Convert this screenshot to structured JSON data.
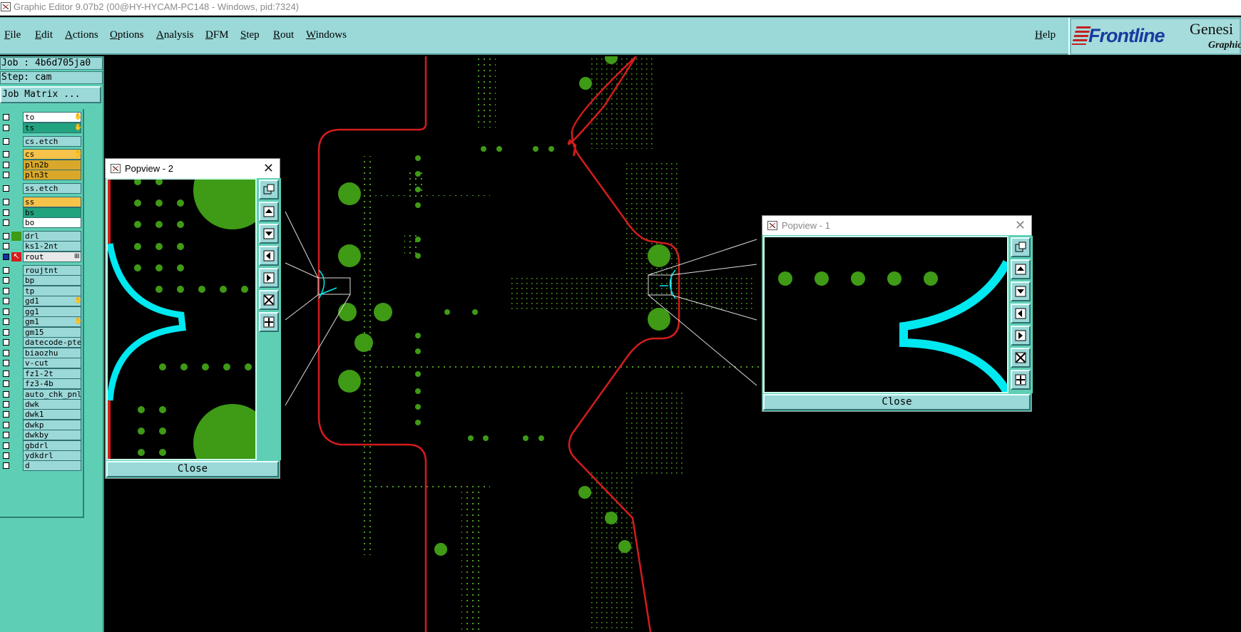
{
  "window": {
    "title": "Graphic Editor 9.07b2 (00@HY-HYCAM-PC148 - Windows, pid:7324)"
  },
  "menu": {
    "items": [
      "File",
      "Edit",
      "Actions",
      "Options",
      "Analysis",
      "DFM",
      "Step",
      "Rout",
      "Windows"
    ],
    "help": "Help"
  },
  "logo": {
    "brand": "Frontline",
    "product": "Genesi",
    "subtitle": "Graphic"
  },
  "job": {
    "job_label": "Job : 4b6d705ja0",
    "step_label": "Step: cam",
    "matrix_button": "Job Matrix ..."
  },
  "layers": [
    {
      "name": "to",
      "color": "#ffffff",
      "mark": "✋"
    },
    {
      "name": "ts",
      "color": "#22a37f",
      "mark": "✋"
    },
    {
      "name": "cs.etch",
      "color": "#9bd8d8",
      "mark": ""
    },
    {
      "name": "cs",
      "color": "#f5c24a",
      "mark": "✋"
    },
    {
      "name": "pln2b",
      "color": "#d9a82a",
      "mark": ""
    },
    {
      "name": "pln3t",
      "color": "#d9a82a",
      "mark": ""
    },
    {
      "name": "ss.etch",
      "color": "#9bd8d8",
      "mark": ""
    },
    {
      "name": "ss",
      "color": "#f5c24a",
      "mark": ""
    },
    {
      "name": "bs",
      "color": "#22a37f",
      "mark": ""
    },
    {
      "name": "bo",
      "color": "#ffffff",
      "mark": ""
    },
    {
      "name": "drl",
      "color": "#9bd8d8",
      "mark": ""
    },
    {
      "name": "ks1-2nt",
      "color": "#9bd8d8",
      "mark": ""
    },
    {
      "name": "rout",
      "color": "#e8e8e8",
      "mark": "⊞"
    },
    {
      "name": "roujtnt",
      "color": "#9bd8d8",
      "mark": ""
    },
    {
      "name": "bp",
      "color": "#9bd8d8",
      "mark": ""
    },
    {
      "name": "tp",
      "color": "#9bd8d8",
      "mark": ""
    },
    {
      "name": "gd1",
      "color": "#9bd8d8",
      "mark": "✋"
    },
    {
      "name": "gg1",
      "color": "#9bd8d8",
      "mark": ""
    },
    {
      "name": "gm1",
      "color": "#9bd8d8",
      "mark": "✋"
    },
    {
      "name": "gm15",
      "color": "#9bd8d8",
      "mark": ""
    },
    {
      "name": "datecode-pte",
      "color": "#9bd8d8",
      "mark": ""
    },
    {
      "name": "biaozhu",
      "color": "#9bd8d8",
      "mark": ""
    },
    {
      "name": "v-cut",
      "color": "#9bd8d8",
      "mark": ""
    },
    {
      "name": "fz1-2t",
      "color": "#9bd8d8",
      "mark": ""
    },
    {
      "name": "fz3-4b",
      "color": "#9bd8d8",
      "mark": ""
    },
    {
      "name": "auto_chk_pnl",
      "color": "#9bd8d8",
      "mark": ""
    },
    {
      "name": "dwk",
      "color": "#9bd8d8",
      "mark": ""
    },
    {
      "name": "dwk1",
      "color": "#9bd8d8",
      "mark": ""
    },
    {
      "name": "dwkp",
      "color": "#9bd8d8",
      "mark": ""
    },
    {
      "name": "dwkby",
      "color": "#9bd8d8",
      "mark": ""
    },
    {
      "name": "gbdrl",
      "color": "#9bd8d8",
      "mark": ""
    },
    {
      "name": "ydkdrl",
      "color": "#9bd8d8",
      "mark": ""
    },
    {
      "name": "d",
      "color": "#9bd8d8",
      "mark": ""
    }
  ],
  "popview2": {
    "title": "Popview - 2",
    "close_label": "Close"
  },
  "popview1": {
    "title": "Popview - 1",
    "close_label": "Close"
  },
  "colors": {
    "pad": "#3f9a16",
    "outline": "#d41c1c",
    "rout": "#00e8f0",
    "panel": "#5ecfb5",
    "button": "#9bd8d8"
  }
}
